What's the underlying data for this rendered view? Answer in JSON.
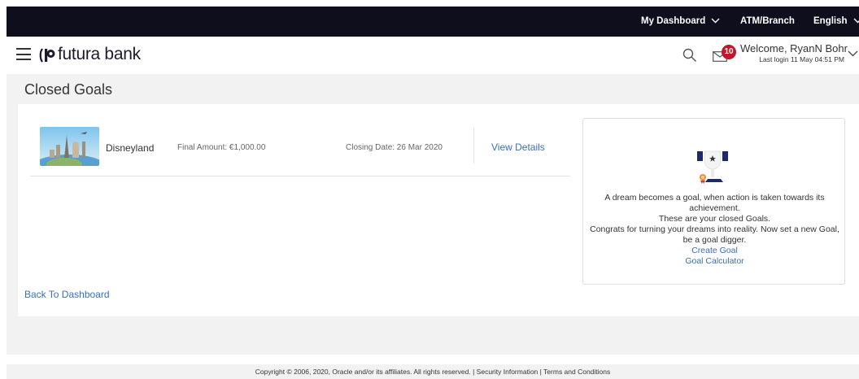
{
  "topbar": {
    "my_dashboard": "My Dashboard",
    "atm_branch": "ATM/Branch",
    "language": "English"
  },
  "header": {
    "brand": "futura bank",
    "notification_count": "10",
    "welcome": "Welcome, RyanN Bohr",
    "last_login": "Last login 11 May 04:51 PM"
  },
  "page": {
    "title": "Closed Goals"
  },
  "goals": [
    {
      "name": "Disneyland",
      "final_amount": "Final Amount: €1,000.00",
      "closing_date": "Closing Date: 26 Mar 2020",
      "view_details": "View Details"
    }
  ],
  "back_link": "Back To Dashboard",
  "info_box": {
    "line1": "A dream becomes a goal, when action is taken towards its achievement.",
    "line2": "These are your closed Goals.",
    "line3": "Congrats for turning your dreams into reality. Now set a new Goal, be a goal digger.",
    "create_goal": "Create Goal",
    "goal_calculator": "Goal Calculator"
  },
  "footer": "Copyright © 2006, 2020, Oracle and/or its affiliates. All rights reserved. | Security Information | Terms and Conditions",
  "colors": {
    "topbar": "#0f0e1d",
    "link": "#3a6fb5",
    "badge": "#c0182a",
    "page_bg": "#f2f2f2"
  },
  "icons": [
    "hamburger-menu-icon",
    "futura-logo-icon",
    "search-icon",
    "mail-icon",
    "chevron-down-icon",
    "trophy-icon"
  ]
}
